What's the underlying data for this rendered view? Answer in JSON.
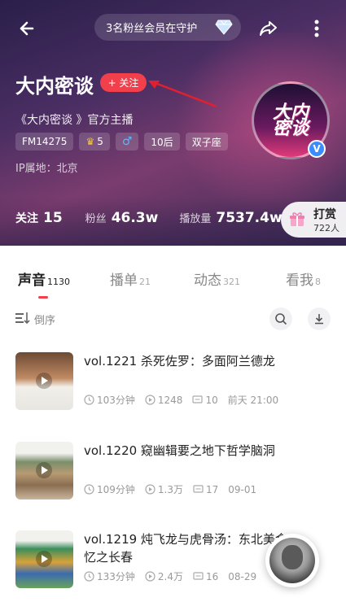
{
  "header": {
    "guard_text": "3名粉丝会员在守护",
    "name": "大内密谈",
    "follow_label": "+ 关注",
    "bio": "《大内密谈 》官方主播",
    "tags": {
      "fm": "FM14275",
      "level": "5",
      "gender": "♂",
      "age": "10后",
      "zodiac": "双子座"
    },
    "ip_location": "IP属地：北京",
    "avatar_logo": "大内密谈",
    "verified_badge": "V",
    "stats": {
      "follow_label": "关注",
      "follow_value": "15",
      "fans_label": "粉丝",
      "fans_value": "46.3w",
      "plays_label": "播放量",
      "plays_value": "7537.4w"
    },
    "reward": {
      "label": "打赏",
      "count": "722人"
    }
  },
  "tabs": [
    {
      "label": "声音",
      "count": "1130",
      "active": true
    },
    {
      "label": "播单",
      "count": "21",
      "active": false
    },
    {
      "label": "动态",
      "count": "321",
      "active": false
    },
    {
      "label": "看我",
      "count": "8",
      "active": false
    }
  ],
  "toolbar": {
    "sort_label": "倒序"
  },
  "tracks": [
    {
      "title": "vol.1221 杀死佐罗：多面阿兰德龙",
      "duration": "103分钟",
      "plays": "1248",
      "comments": "10",
      "date": "前天 21:00"
    },
    {
      "title": "vol.1220 窥幽辑要之地下哲学脑洞",
      "duration": "109分钟",
      "plays": "1.3万",
      "comments": "17",
      "date": "09-01"
    },
    {
      "title": "vol.1219 炖飞龙与虎骨汤：东北美食",
      "title_line2": "忆之长春",
      "duration": "133分钟",
      "plays": "2.4万",
      "comments": "16",
      "date": "08-29"
    }
  ],
  "colors": {
    "accent_red": "#f1404b",
    "verified_blue": "#3a8cff"
  },
  "icons": [
    "back-arrow-icon",
    "diamond-icon",
    "share-icon",
    "more-vertical-icon",
    "crown-icon",
    "gift-icon",
    "sort-icon",
    "search-icon",
    "download-icon",
    "clock-icon",
    "play-count-icon",
    "comment-icon",
    "play-icon"
  ]
}
